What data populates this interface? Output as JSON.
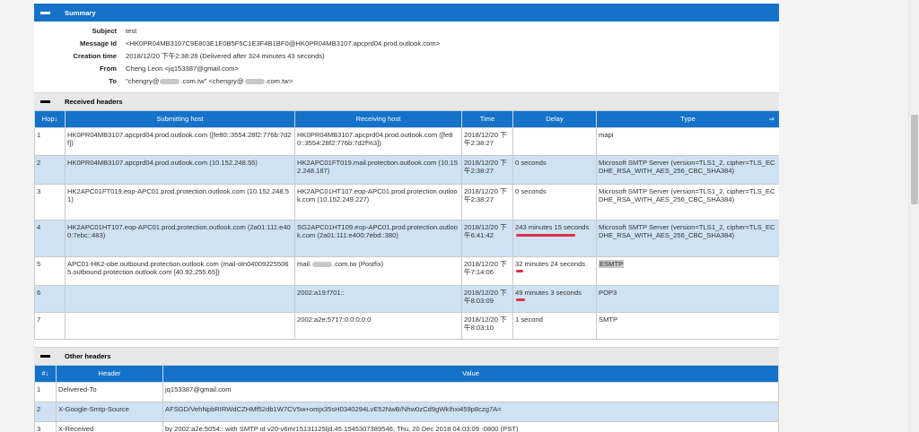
{
  "summary": {
    "title": "Summary",
    "labels": {
      "subject": "Subject",
      "message_id": "Message Id",
      "creation_time": "Creation time",
      "from": "From",
      "to": "To"
    },
    "subject": "test",
    "message_id": "<HK0PR04MB3107C9E803E1E0B5F5C1E3F4B1BF0@HK0PR04MB3107.apcprd04.prod.outlook.com>",
    "creation_time": "2018/12/20 下午2:38:26 (Delivered after 324 minutes 43 seconds)",
    "from": "Cheng Leon <jq153387@gmail.com>",
    "to_a": "\"chengry@",
    "to_b": ".com.tw\" <chengry@",
    "to_c": ".com.tw>"
  },
  "received": {
    "title": "Received headers",
    "columns": [
      "Hop↓",
      "Submitting host",
      "Receiving host",
      "Time",
      "Delay",
      "Type"
    ],
    "type_arrow": "⇒",
    "rows": [
      {
        "hop": "1",
        "sub": "HK0PR04MB3107.apcprd04.prod.outlook.com ([fe80::3554:28f2:776b:7d2f])",
        "rec": "HK0PR04MB3107.apcprd04.prod.outlook.com ([fe80::3554:28f2:776b:7d2f%3])",
        "time": "2018/12/20 下午2:38:27",
        "delay": "",
        "type": "mapi"
      },
      {
        "hop": "2",
        "sub": "HK0PR04MB3107.apcprd04.prod.outlook.com (10.152.248.55)",
        "rec": "HK2APC01FT019.mail.protection.outlook.com (10.152.248.187)",
        "time": "2018/12/20 下午2:38:27",
        "delay": "0 seconds",
        "type": "Microsoft SMTP Server (version=TLS1_2, cipher=TLS_ECDHE_RSA_WITH_AES_256_CBC_SHA384)"
      },
      {
        "hop": "3",
        "sub": "HK2APC01FT019.eop-APC01.prod.protection.outlook.com (10.152.248.51)",
        "rec": "HK2APC01HT107.eop-APC01.prod.protection.outlook.com (10.152.249.227)",
        "time": "2018/12/20 下午2:38:27",
        "delay": "0 seconds",
        "type": "Microsoft SMTP Server (version=TLS1_2, cipher=TLS_ECDHE_RSA_WITH_AES_256_CBC_SHA384)"
      },
      {
        "hop": "4",
        "sub": "HK2APC01HT107.eop-APC01.prod.protection.outlook.com (2a01:111:e400:7ebc::483)",
        "rec": "SG2APC01HT109.eop-APC01.prod.protection.outlook.com (2a01:111:e400:7ebd::380)",
        "time": "2018/12/20 下午6:41:42",
        "delay": "243 minutes 15 seconds",
        "type": "Microsoft SMTP Server (version=TLS1_2, cipher=TLS_ECDHE_RSA_WITH_AES_256_CBC_SHA384)"
      },
      {
        "hop": "5",
        "sub": "APC01-HK2-obe.outbound.protection.outlook.com (mail-oln040092255065.outbound.protection.outlook.com [40.92.255.65])",
        "rec_a": "mail.",
        "rec_b": ".com.tw (Postfix)",
        "time": "2018/12/20 下午7:14:06",
        "delay": "32 minutes 24 seconds",
        "type": "ESMTP"
      },
      {
        "hop": "6",
        "sub": "",
        "rec": "2002:a19:f701::",
        "time": "2018/12/20 下午8:03:09",
        "delay": "49 minutes 3 seconds",
        "type": "POP3"
      },
      {
        "hop": "7",
        "sub": "",
        "rec": "2002:a2e:5717:0:0:0:0:0",
        "time": "2018/12/20 下午8:03:10",
        "delay": "1 second",
        "type": "SMTP"
      }
    ]
  },
  "other": {
    "title": "Other headers",
    "columns": [
      "#↓",
      "Header",
      "Value"
    ],
    "rows": [
      {
        "n": "1",
        "header": "Delivered-To",
        "value": "jq153387@gmail.com"
      },
      {
        "n": "2",
        "header": "X-Google-Smtp-Source",
        "value": "AFSGD/VehNpbRIRWdCZHMf52db1W7CV5w+omjx35sH0340294LvE52NwB/Nhw0zCd9gWkIhxi459p8czg7A="
      },
      {
        "n": "3",
        "header": "X-Received",
        "value": "by 2002:a2e:5054:: with SMTP id v20-v6mr15131125ljd.45.1545307389546; Thu, 20 Dec 2018 04:03:09 -0800 (PST)"
      }
    ]
  },
  "colors": {
    "accent": "#1572c8",
    "alt_row": "#cfe2f3",
    "annotation": "#e0314a"
  }
}
